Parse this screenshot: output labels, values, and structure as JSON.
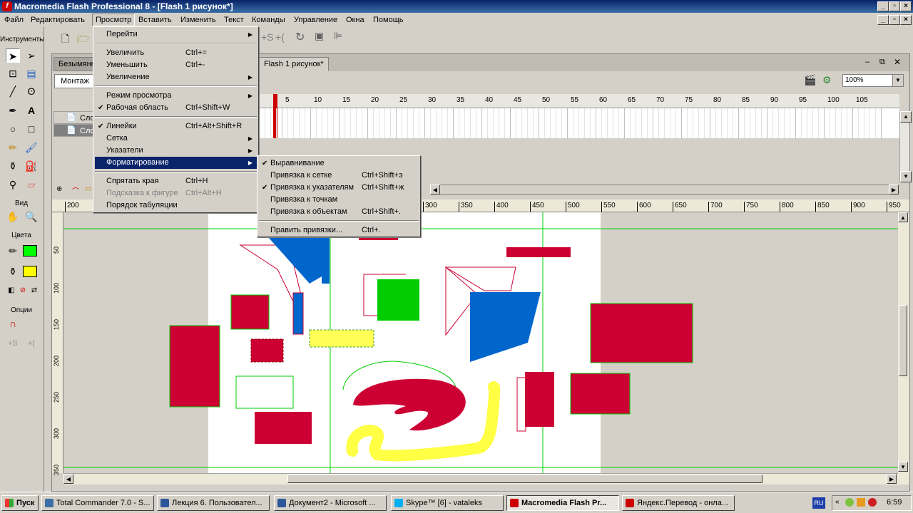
{
  "window": {
    "title": "Macromedia Flash Professional 8 - [Flash 1 рисунок*]"
  },
  "menubar": [
    "Файл",
    "Редактировать",
    "Просмотр",
    "Вставить",
    "Изменить",
    "Текст",
    "Команды",
    "Управление",
    "Окна",
    "Помощь"
  ],
  "tools": {
    "header": "Инструменты",
    "view_label": "Вид",
    "colors_label": "Цвета",
    "options_label": "Опции",
    "stroke_color": "#000000",
    "fill_color": "#00ff00",
    "fill_color2": "#ffff00"
  },
  "document": {
    "tabs": [
      "Безымянн",
      "Flash 1 рисунок*"
    ],
    "scene": "Монтаж",
    "zoom": "100%"
  },
  "timeline": {
    "layers": [
      "Сло",
      "Сло"
    ],
    "frame_numbers": [
      "5",
      "10",
      "15",
      "20",
      "25",
      "30",
      "35",
      "40",
      "45",
      "50",
      "55",
      "60",
      "65",
      "70",
      "75",
      "80",
      "85",
      "90",
      "95",
      "100",
      "105"
    ]
  },
  "rulers": {
    "h": [
      "200",
      "300",
      "350",
      "400",
      "450",
      "500",
      "550",
      "600",
      "650",
      "700",
      "750",
      "800",
      "850",
      "900",
      "950"
    ],
    "v": [
      "50",
      "100",
      "150",
      "200",
      "250",
      "300",
      "350"
    ]
  },
  "view_menu": {
    "items": [
      {
        "label": "Перейти",
        "shortcut": "",
        "submenu": true,
        "checked": false,
        "disabled": false
      },
      {
        "label": "Увеличить",
        "shortcut": "Ctrl+=",
        "submenu": false,
        "checked": false,
        "disabled": false
      },
      {
        "label": "Уменьшить",
        "shortcut": "Ctrl+-",
        "submenu": false,
        "checked": false,
        "disabled": false
      },
      {
        "label": "Увеличение",
        "shortcut": "",
        "submenu": true,
        "checked": false,
        "disabled": false
      },
      {
        "label": "Режим просмотра",
        "shortcut": "",
        "submenu": true,
        "checked": false,
        "disabled": false
      },
      {
        "label": "Рабочая область",
        "shortcut": "Ctrl+Shift+W",
        "submenu": false,
        "checked": true,
        "disabled": false
      },
      {
        "label": "Линейки",
        "shortcut": "Ctrl+Alt+Shift+R",
        "submenu": false,
        "checked": true,
        "disabled": false
      },
      {
        "label": "Сетка",
        "shortcut": "",
        "submenu": true,
        "checked": false,
        "disabled": false
      },
      {
        "label": "Указатели",
        "shortcut": "",
        "submenu": true,
        "checked": false,
        "disabled": false
      },
      {
        "label": "Форматирование",
        "shortcut": "",
        "submenu": true,
        "checked": false,
        "disabled": false,
        "highlighted": true
      },
      {
        "label": "Спрятать края",
        "shortcut": "Ctrl+H",
        "submenu": false,
        "checked": false,
        "disabled": false
      },
      {
        "label": "Подсказка к фигуре",
        "shortcut": "Ctrl+Alt+H",
        "submenu": false,
        "checked": false,
        "disabled": true
      },
      {
        "label": "Порядок табуляции",
        "shortcut": "",
        "submenu": false,
        "checked": false,
        "disabled": false
      }
    ]
  },
  "snap_menu": {
    "items": [
      {
        "label": "Выравнивание",
        "shortcut": "",
        "checked": true
      },
      {
        "label": "Привязка к сетке",
        "shortcut": "Ctrl+Shift+э",
        "checked": false
      },
      {
        "label": "Привязка к указателям",
        "shortcut": "Ctrl+Shift+ж",
        "checked": true
      },
      {
        "label": "Привязка к точкам",
        "shortcut": "",
        "checked": false
      },
      {
        "label": "Привязка к объектам",
        "shortcut": "Ctrl+Shift+.",
        "checked": false
      },
      {
        "label": "Править привязки...",
        "shortcut": "Ctrl+.",
        "checked": false
      }
    ]
  },
  "taskbar": {
    "start": "Пуск",
    "tasks": [
      {
        "label": "Total Commander 7.0 - S...",
        "color": "#3a6ea5"
      },
      {
        "label": "Лекция 6. Пользовател...",
        "color": "#2b579a"
      },
      {
        "label": "Документ2 - Microsoft ...",
        "color": "#2b579a"
      },
      {
        "label": "Skype™ [6] - vataleks",
        "color": "#00aff0"
      },
      {
        "label": "Macromedia Flash Pr...",
        "color": "#cc0000"
      },
      {
        "label": "Яндекс.Перевод - онла...",
        "color": "#cc0000"
      }
    ],
    "lang": "RU",
    "clock": "6:59"
  }
}
